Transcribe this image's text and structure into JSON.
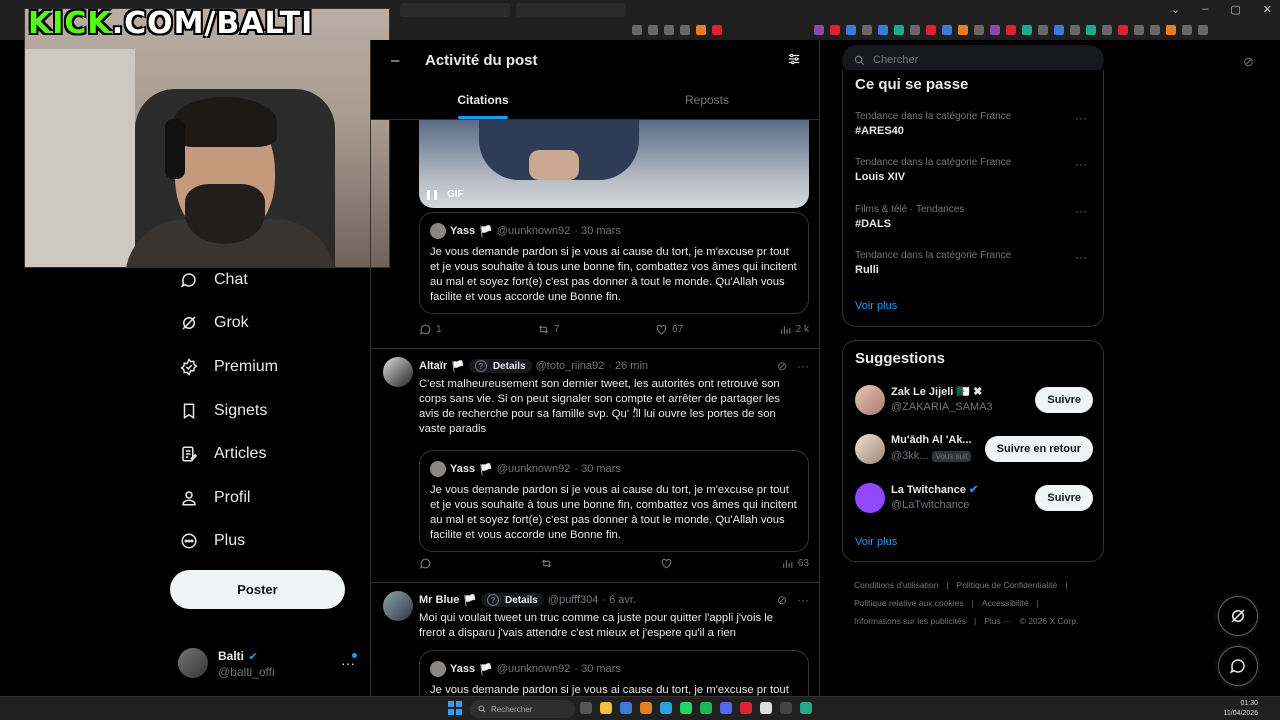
{
  "overlay": {
    "brand": "KICK",
    "rest": ".COM/BALTI"
  },
  "sidebar": {
    "items": [
      {
        "label": "Chat",
        "icon": "chat-icon"
      },
      {
        "label": "Grok",
        "icon": "grok-icon"
      },
      {
        "label": "Premium",
        "icon": "premium-icon"
      },
      {
        "label": "Signets",
        "icon": "bookmark-icon"
      },
      {
        "label": "Articles",
        "icon": "articles-icon"
      },
      {
        "label": "Profil",
        "icon": "profile-icon"
      },
      {
        "label": "Plus",
        "icon": "more-circle-icon"
      }
    ],
    "post_label": "Poster",
    "account": {
      "name": "Balti",
      "handle": "@balti_offi"
    }
  },
  "main": {
    "title": "Activité du post",
    "tabs": [
      {
        "label": "Citations"
      },
      {
        "label": "Reposts"
      }
    ],
    "gif_label": "GIF",
    "quoted": {
      "name": "Yass",
      "handle": "@uunknown92",
      "date": "· 30 mars",
      "text": "Je vous demande pardon si je vous ai cause du tort, je m'excuse pr tout et je vous souhaite à tous une bonne fin, combattez vos âmes qui incitent au mal et soyez fort(e) c'est pas donner à tout le monde. Qu'Allah vous facilite et vous accorde une Bonne fin."
    },
    "first_actions": {
      "replies": "1",
      "reposts": "7",
      "likes": "67",
      "views": "2 k"
    },
    "tweets": [
      {
        "name": "Altaïr",
        "details": "Details",
        "handle": "@toto_riina92",
        "time": "· 26 min",
        "text": "C'est malheureusement son dernier tweet, les autorités ont retrouvé son corps sans vie. Si on peut signaler son compte et arrêter de partager les avis de recherche pour sa famille svp. Qu' ؛ؕll lui ouvre les portes de son vaste paradis",
        "views": "63"
      },
      {
        "name": "Mr Blue",
        "details": "Details",
        "handle": "@pufff304",
        "time": "· 6 avr.",
        "text": "Moi qui voulait tweet un truc comme ca juste pour quitter l'appli j'vois le frerot a disparu j'vais attendre c'est mieux et j'espere qu'il a rien"
      }
    ]
  },
  "right": {
    "search_placeholder": "Chercher",
    "trends_title": "Ce qui se passe",
    "trends": [
      {
        "category": "Tendance dans la catégorie France",
        "name": "#ARES40"
      },
      {
        "category": "Tendance dans la catégorie France",
        "name": "Louis XIV"
      },
      {
        "category": "Films & télé · Tendances",
        "name": "#DALS"
      },
      {
        "category": "Tendance dans la catégorie France",
        "name": "Rulli"
      }
    ],
    "show_more": "Voir plus",
    "suggestions_title": "Suggestions",
    "suggestions": [
      {
        "name": "Zak Le Jijeli 🇩🇿 ✖",
        "handle": "@ZAKARIA_SAMA3",
        "button": "Suivre"
      },
      {
        "name": "Mu'ādh Al 'Ak...",
        "handle": "@3kk...",
        "follows_you": "Vous suit",
        "button": "Suivre en retour"
      },
      {
        "name": "La Twitchance",
        "handle": "@LaTwitchance",
        "button": "Suivre"
      }
    ],
    "footer": [
      "Conditions d'utilisation",
      "Politique de Confidentialité",
      "Politique relative aux cookies",
      "Accessibilité",
      "Informations sur les publicités",
      "Plus ···",
      "© 2026 X Corp."
    ]
  },
  "taskbar": {
    "search": "Rechercher",
    "time": "01:30",
    "date": "11/04/2026"
  }
}
